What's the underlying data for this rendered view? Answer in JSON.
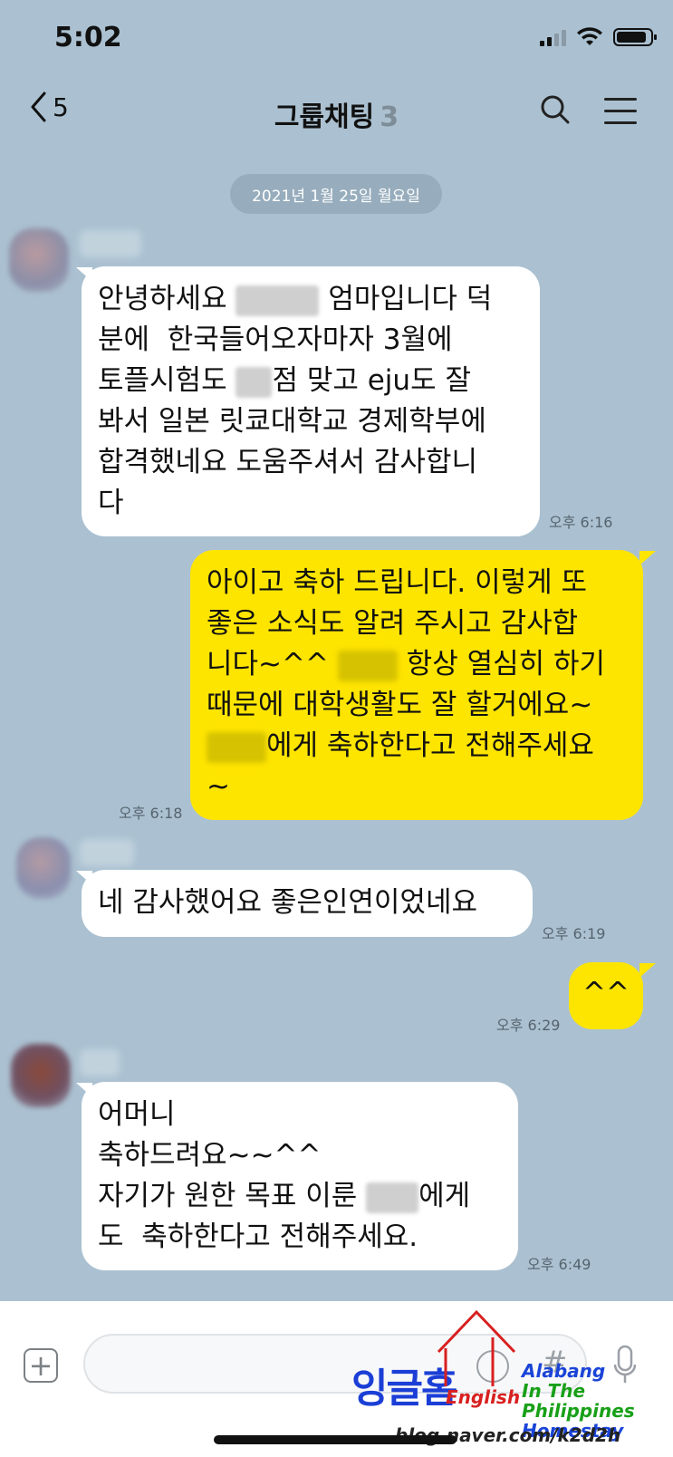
{
  "status_bar": {
    "time": "5:02"
  },
  "header": {
    "back_count": "5",
    "title": "그룹채팅",
    "member_count": "3"
  },
  "date_divider": "2021년 1월 25일 월요일",
  "messages": [
    {
      "side": "in",
      "parts": [
        "안녕하세요 ",
        " 엄마입니다 덕\n분에  한국들어오자마자 3월에\n토플시험도 ",
        "점 맞고 eju도 잘\n봐서 일본 릿쿄대학교 경제학부에\n합격했네요 도움주셔서 감사합니\n다"
      ],
      "time": "오후 6:16"
    },
    {
      "side": "out",
      "parts": [
        "아이고 축하 드립니다. 이렇게 또\n좋은 소식도 알려 주시고 감사합\n니다~^^ ",
        " 항상 열심히 하기\n때문에 대학생활도 잘 할거에요~\n",
        "에게 축하한다고 전해주세요\n~"
      ],
      "time": "오후 6:18"
    },
    {
      "side": "in",
      "parts": [
        "네 감사했어요 좋은인연이었네요"
      ],
      "time": "오후 6:19"
    },
    {
      "side": "out",
      "parts": [
        "^^"
      ],
      "time": "오후 6:29"
    },
    {
      "side": "in",
      "parts": [
        "어머니\n축하드려요~~^^\n자기가 원한 목표 이룬 ",
        "에게\n도  축하한다고 전해주세요."
      ],
      "time": "오후 6:49"
    }
  ],
  "input": {
    "placeholder": ""
  },
  "watermark": {
    "korean": "잉글홈",
    "english": "English",
    "lines": [
      "Alabang",
      "In The Philippines",
      "Homestay"
    ],
    "url": "blog.naver.com/k2d2h"
  },
  "colors": {
    "background": "#abc1d1",
    "outgoing_bubble": "#fee500",
    "incoming_bubble": "#ffffff"
  },
  "icons": [
    "back-chevron-icon",
    "search-icon",
    "menu-icon",
    "plus-icon",
    "emoji-icon",
    "hash-icon",
    "mic-icon",
    "wifi-icon",
    "signal-icon",
    "battery-icon"
  ]
}
